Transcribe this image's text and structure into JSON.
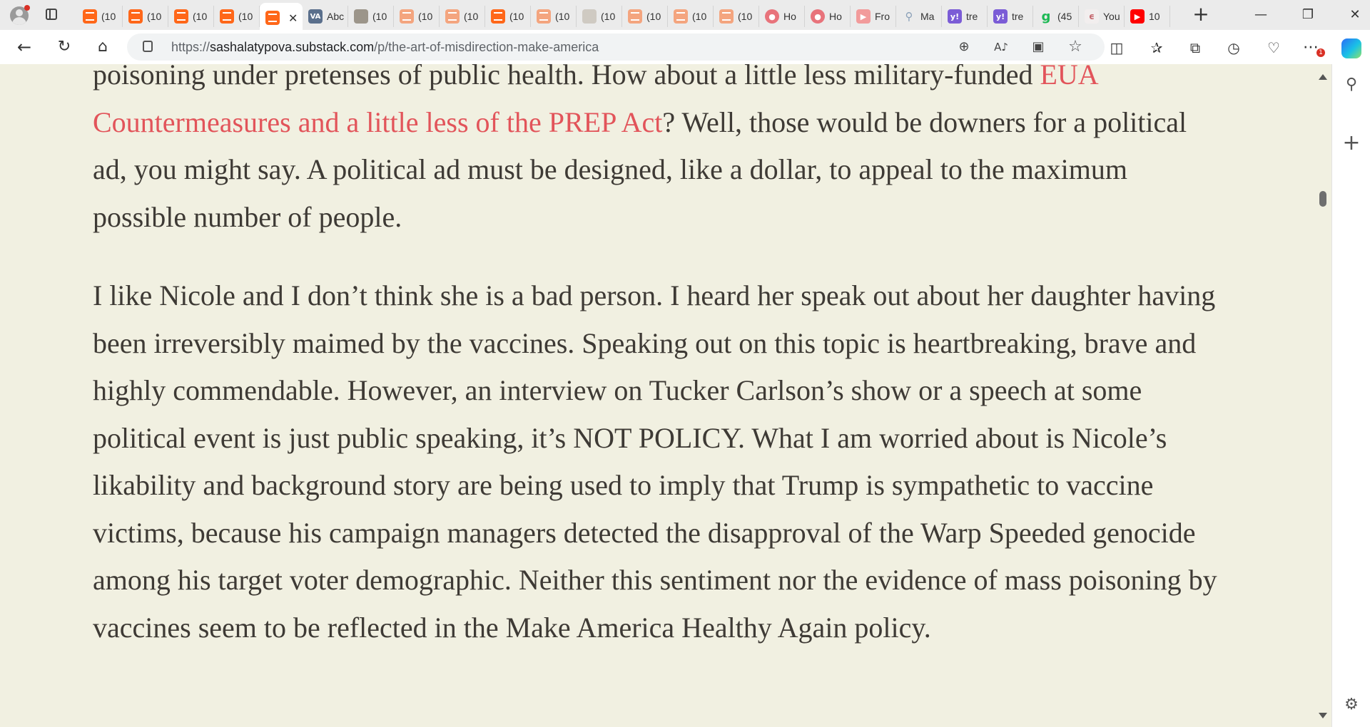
{
  "browser": {
    "tabs": [
      {
        "icon": "substack-icon",
        "label": "(10"
      },
      {
        "icon": "substack-icon",
        "label": "(10"
      },
      {
        "icon": "substack-icon",
        "label": "(10"
      },
      {
        "icon": "substack-icon",
        "label": "(10"
      },
      {
        "icon": "substack-icon",
        "label": "",
        "active": true
      },
      {
        "icon": "va-icon",
        "icon_text": "VA",
        "label": "Abc"
      },
      {
        "icon": "photo-icon",
        "label": "(10"
      },
      {
        "icon": "substack-faded-icon",
        "label": "(10"
      },
      {
        "icon": "substack-faded-icon",
        "label": "(10"
      },
      {
        "icon": "substack-icon",
        "label": "(10"
      },
      {
        "icon": "substack-faded-icon",
        "label": "(10"
      },
      {
        "icon": "person-icon",
        "label": "(10"
      },
      {
        "icon": "substack-faded-icon",
        "label": "(10"
      },
      {
        "icon": "substack-faded-icon",
        "label": "(10"
      },
      {
        "icon": "substack-faded-icon",
        "label": "(10"
      },
      {
        "icon": "pink-avatar-icon",
        "label": "Ho"
      },
      {
        "icon": "pink-avatar-icon",
        "label": "Ho"
      },
      {
        "icon": "youtube-faded-icon",
        "label": "Fro"
      },
      {
        "icon": "search-icon",
        "label": "Ma"
      },
      {
        "icon": "yahoo-icon",
        "icon_text": "y!",
        "label": "tre"
      },
      {
        "icon": "yahoo-icon",
        "icon_text": "y!",
        "label": "tre"
      },
      {
        "icon": "grammarly-icon",
        "icon_text": "g",
        "label": "(45"
      },
      {
        "icon": "generic-icon",
        "label": "You"
      },
      {
        "icon": "youtube-icon",
        "label": "10"
      }
    ],
    "active_tab_close": "✕",
    "new_tab": "+",
    "window_controls": {
      "minimize": "—",
      "maximize": "❐",
      "close": "✕"
    },
    "url": {
      "scheme": "https://",
      "host": "sashalatypova.substack.com",
      "path": "/p/the-art-of-misdirection-make-america"
    },
    "notification_count": "1"
  },
  "article": {
    "paragraph1": {
      "line1": "poisoning under pretenses of public health. How about a little less military-funded ",
      "link": "EUA Countermeasures and a little less of the PREP Act",
      "rest": "? Well, those would be downers for a political ad, you might say. A political ad must be designed, like a dollar, to appeal to the maximum possible number of people."
    },
    "paragraph2": "I like Nicole and I don’t think she is a bad person. I heard her speak out about her daughter having been irreversibly maimed by the vaccines. Speaking out on this topic is heartbreaking, brave and highly commendable. However, an interview on Tucker Carlson’s show or a speech at some political event is just public speaking, it’s NOT POLICY. What I am worried about is Nicole’s likability and background story are being used to imply that Trump is sympathetic to vaccine victims, because his campaign managers detected the disapproval of the Warp Speeded genocide among his target voter demographic. Neither this sentiment nor the evidence of mass poisoning by vaccines seem to be reflected in the Make America Healthy Again policy."
  },
  "colors": {
    "page_background": "#f1f0e1",
    "text": "#3e3a35",
    "link": "#e2545a",
    "substack_orange": "#ff6719"
  }
}
